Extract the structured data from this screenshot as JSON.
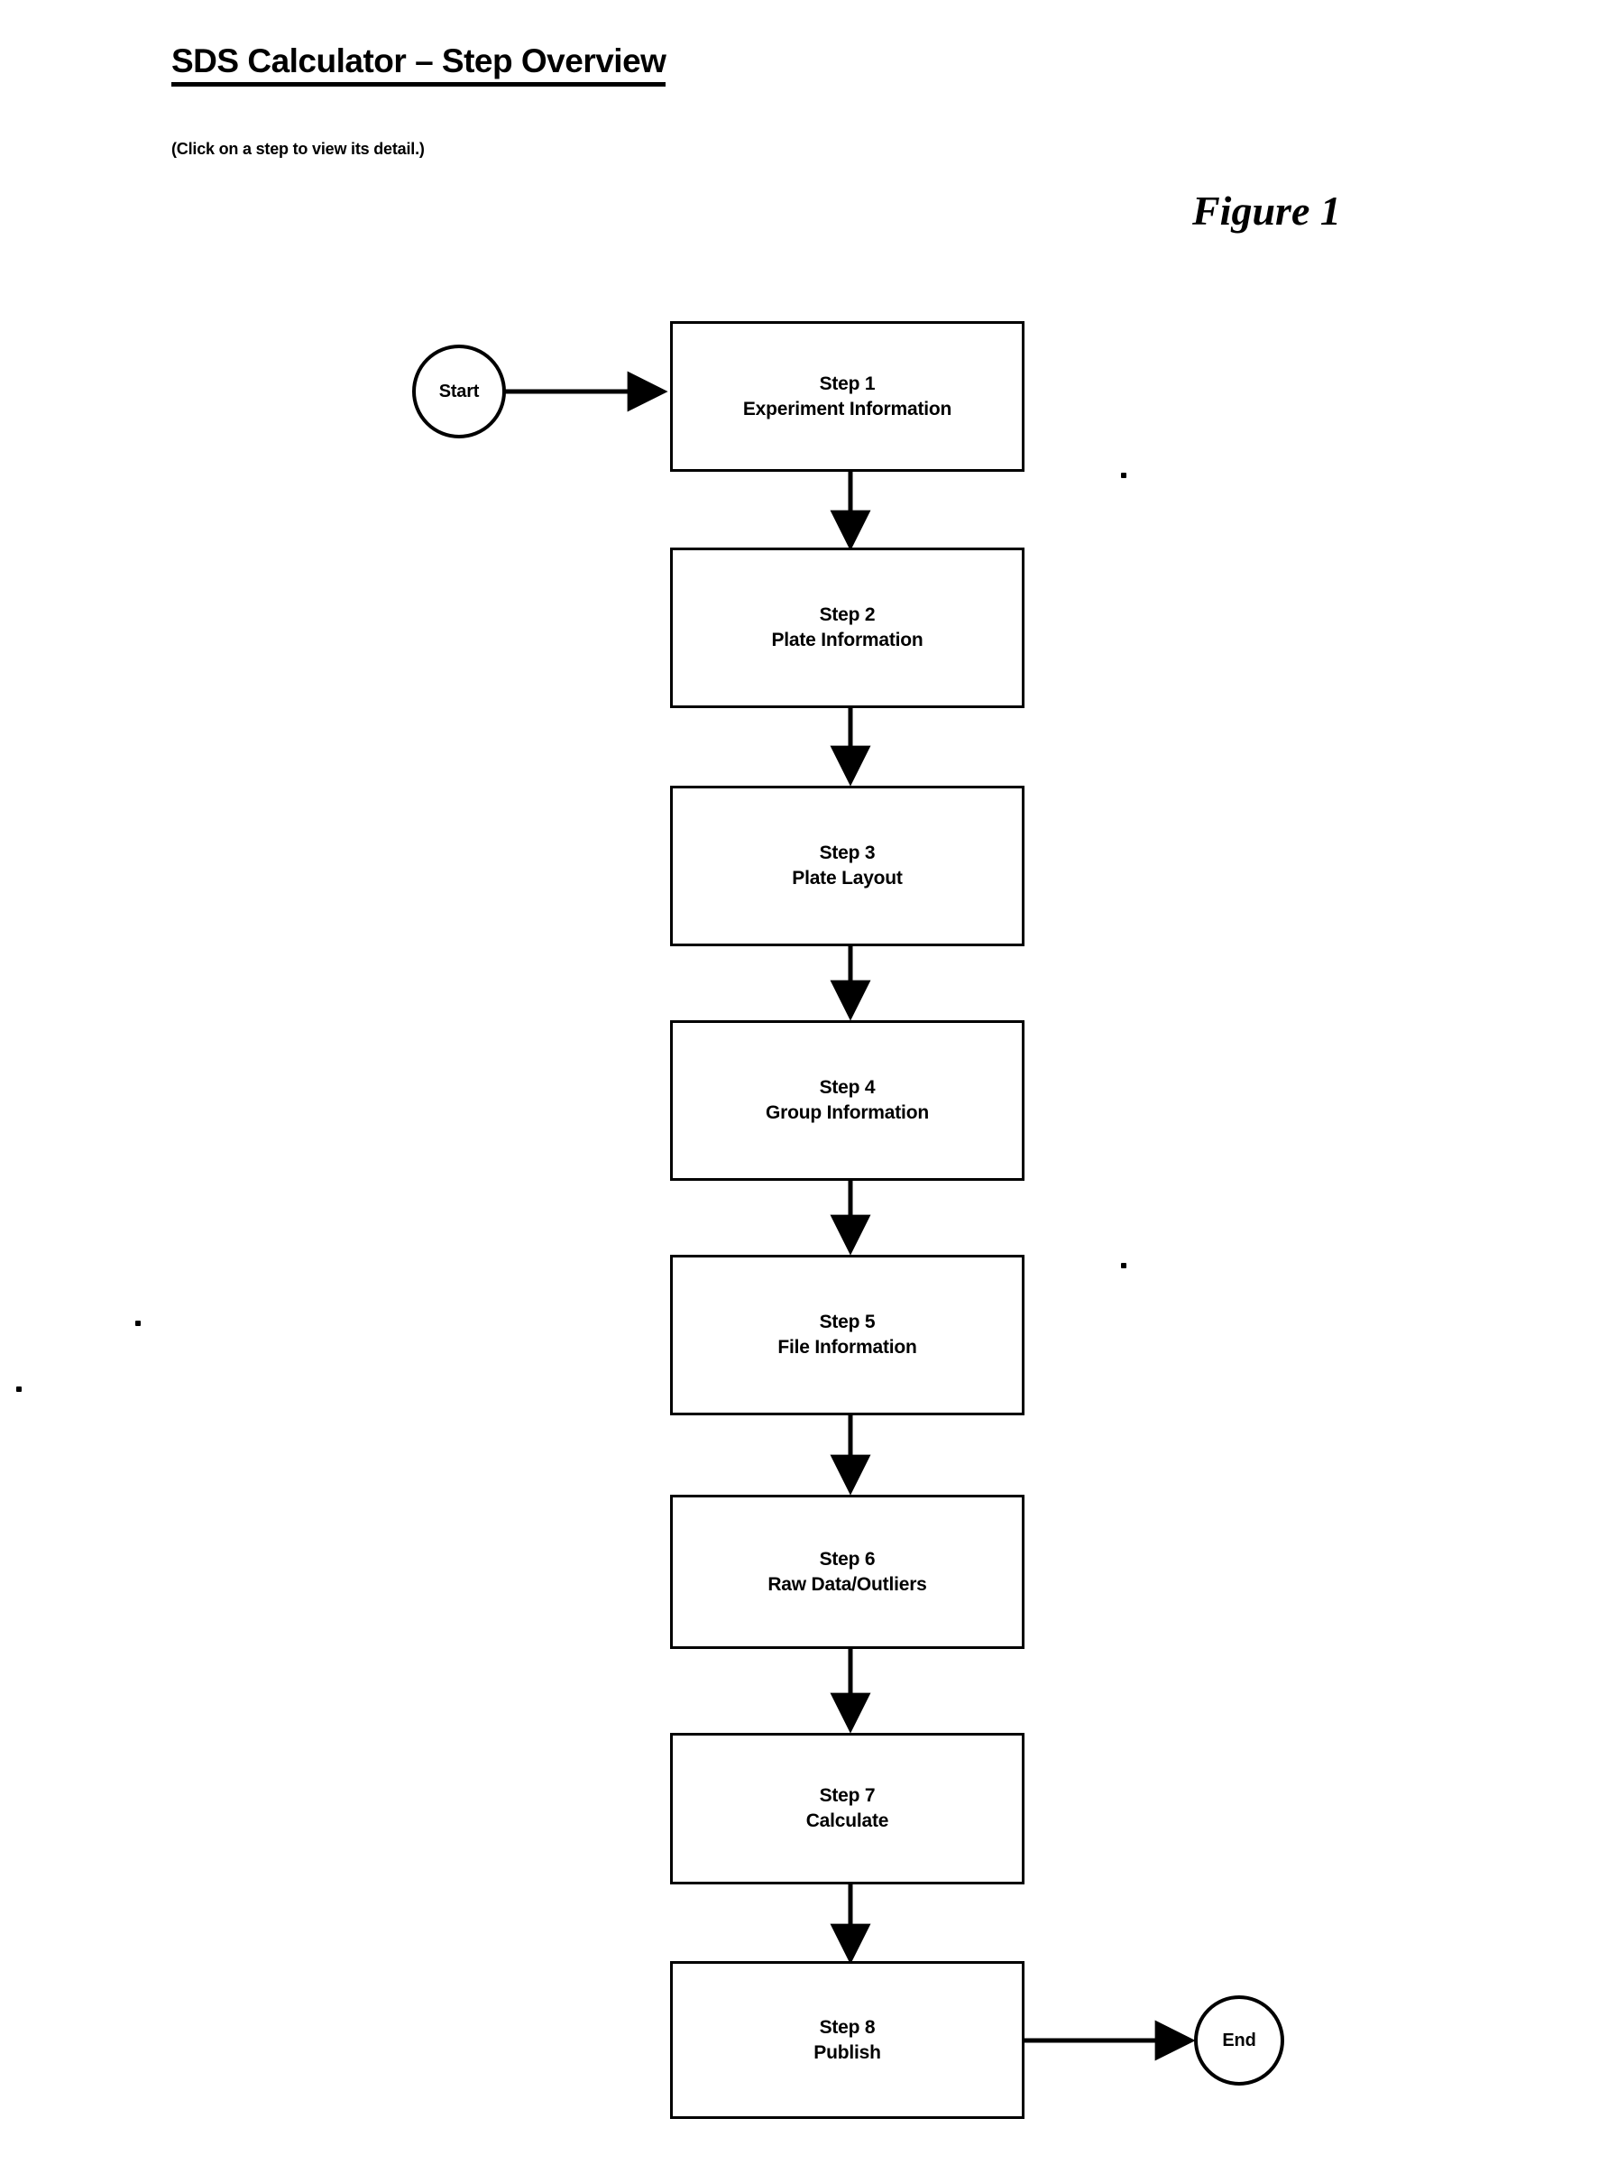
{
  "header": {
    "title": "SDS Calculator – Step Overview",
    "subtitle": "(Click on a step to view its detail.)",
    "figure_label": "Figure 1"
  },
  "diagram": {
    "type": "flowchart",
    "orientation": "vertical",
    "start_label": "Start",
    "end_label": "End",
    "nodes": [
      {
        "id": "step1",
        "line1": "Step 1",
        "line2": "Experiment Information"
      },
      {
        "id": "step2",
        "line1": "Step 2",
        "line2": "Plate Information"
      },
      {
        "id": "step3",
        "line1": "Step 3",
        "line2": "Plate Layout"
      },
      {
        "id": "step4",
        "line1": "Step 4",
        "line2": "Group Information"
      },
      {
        "id": "step5",
        "line1": "Step 5",
        "line2": "File Information"
      },
      {
        "id": "step6",
        "line1": "Step 6",
        "line2": "Raw Data/Outliers"
      },
      {
        "id": "step7",
        "line1": "Step 7",
        "line2": "Calculate"
      },
      {
        "id": "step8",
        "line1": "Step 8",
        "line2": "Publish"
      }
    ],
    "edges": [
      {
        "from": "Start",
        "to": "Step 1"
      },
      {
        "from": "Step 1",
        "to": "Step 2"
      },
      {
        "from": "Step 2",
        "to": "Step 3"
      },
      {
        "from": "Step 3",
        "to": "Step 4"
      },
      {
        "from": "Step 4",
        "to": "Step 5"
      },
      {
        "from": "Step 5",
        "to": "Step 6"
      },
      {
        "from": "Step 6",
        "to": "Step 7"
      },
      {
        "from": "Step 7",
        "to": "Step 8"
      },
      {
        "from": "Step 8",
        "to": "End"
      }
    ],
    "colors": {
      "stroke": "#000000",
      "fill": "#ffffff",
      "text": "#000000"
    }
  }
}
